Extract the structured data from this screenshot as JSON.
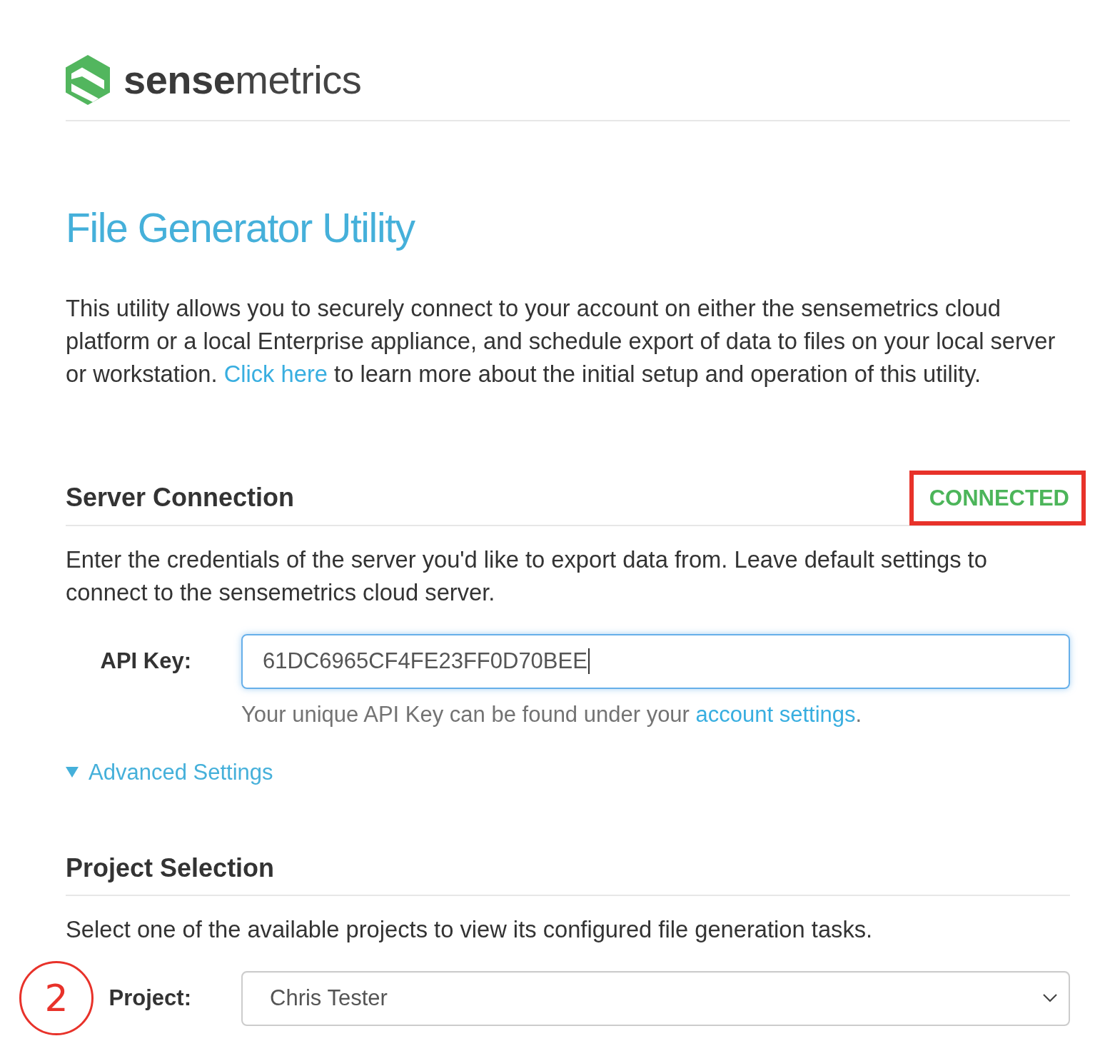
{
  "header": {
    "brand": "**sense**metrics"
  },
  "title": "File Generator Utility",
  "intro": {
    "before": "This utility allows you to securely connect to your account on either the sensemetrics cloud platform or a local Enterprise appliance, and schedule export of data to files on your local server or workstation. ",
    "link": "Click here",
    "after": " to learn more about the initial setup and operation of this utility."
  },
  "server_connection": {
    "heading": "Server Connection",
    "status": {
      "label": "CONNECTED",
      "kind": "connected",
      "highlighted": true
    },
    "description": "Enter the credentials of the server you'd like to export data from. Leave default settings to connect to the sensemetrics cloud server.",
    "api_key": {
      "label": "API Key:",
      "value": "61DC6965CF4FE23FF0D70BEE",
      "focused": true
    },
    "help": {
      "before": "Your unique API Key can be found under your ",
      "link": "account settings",
      "after": "."
    },
    "advanced_settings": {
      "label": "Advanced Settings"
    }
  },
  "project_selection": {
    "heading": "Project Selection",
    "description": "Select one of the available projects to view its configured file generation tasks.",
    "project": {
      "label": "Project:",
      "value": "Chris Tester",
      "step_marker": "2"
    }
  }
}
